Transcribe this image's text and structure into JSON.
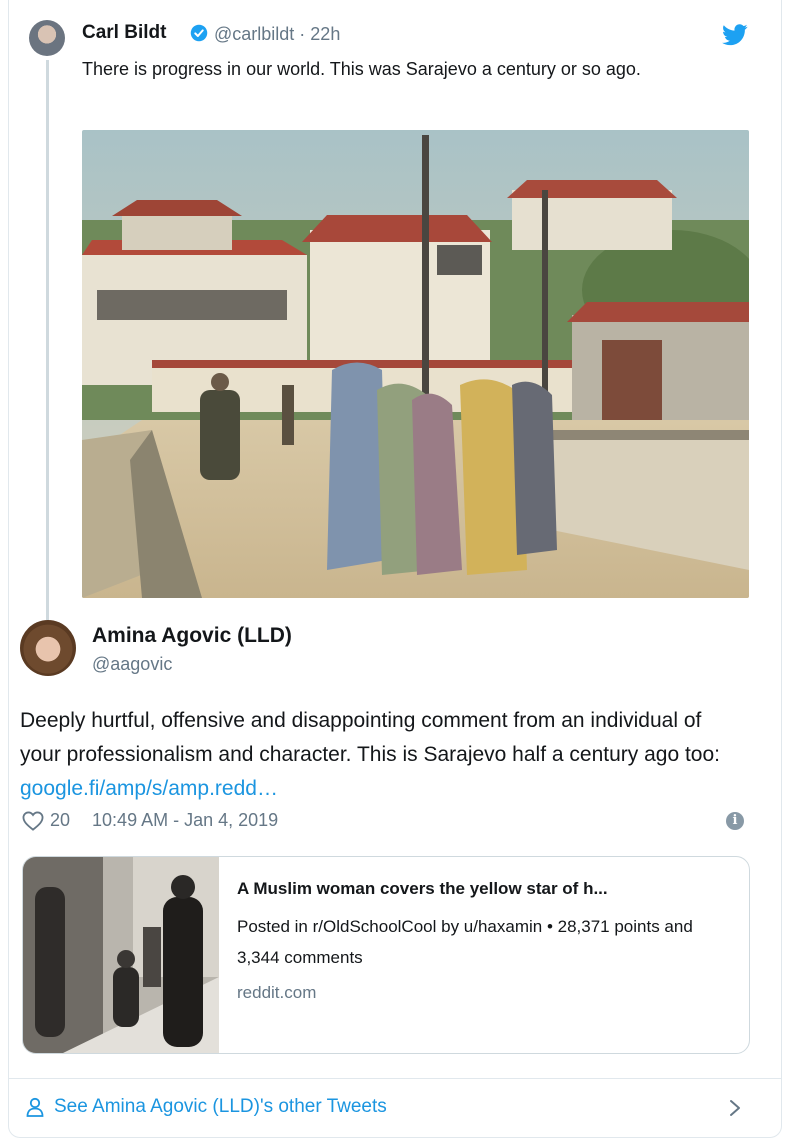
{
  "quoted_tweet": {
    "name": "Carl Bildt",
    "handle": "@carlbildt · 22h",
    "text": "There is progress in our world. This was Sarajevo a century or so ago.",
    "image_icon": "photo"
  },
  "tweet": {
    "name": "Amina Agovic (LLD)",
    "handle": "@aagovic",
    "text": "Deeply hurtful, offensive and disappointing comment from an individual of your professionalism and character. This is Sarajevo half a century ago too: ",
    "link": "google.fi/amp/s/amp.redd…",
    "likes": "20",
    "timestamp": "10:49 AM - Jan 4, 2019"
  },
  "link_card": {
    "title": "A Muslim woman covers the yellow star of h...",
    "description": "Posted in r/OldSchoolCool by u/haxamin • 28,371 points and 3,344 comments",
    "domain": "reddit.com"
  },
  "footer": {
    "label": "See Amina Agovic (LLD)'s other Tweets"
  },
  "colors": {
    "link": "#1b95e0",
    "muted": "#657786",
    "text": "#14171a"
  }
}
